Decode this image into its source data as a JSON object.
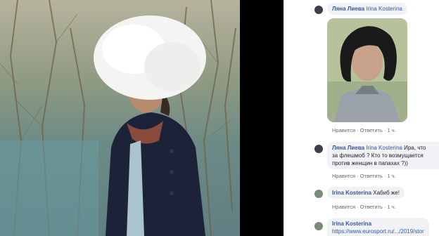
{
  "comments": [
    {
      "author": "Ляна Лиева",
      "mention": "Irina Kosterina",
      "text": "",
      "attachment": "photo",
      "actions": {
        "like": "Нравится",
        "reply": "Ответить",
        "time": "1 ч."
      },
      "avatar_icon": "user-avatar-icon"
    },
    {
      "author": "Ляна Лиева",
      "mention": "Irina Kosterina",
      "text_line1": "Ира, что",
      "text_line2": "за флешмоб ? Кто то возмущается",
      "text_line3": "против женщин в папахах ?))",
      "actions": {
        "like": "Нравится",
        "reply": "Ответить",
        "time": "1 ч."
      },
      "avatar_icon": "user-avatar-icon"
    },
    {
      "author": "Irina Kosterina",
      "text": "Хабиб же!",
      "actions": {
        "like": "Нравится",
        "reply": "Ответить",
        "time": "1 ч."
      },
      "avatar_icon": "user-avatar-icon"
    },
    {
      "author": "Irina Kosterina",
      "link": "https://www.eurosport.ru/.../2019/stor",
      "avatar_icon": "user-avatar-icon"
    }
  ],
  "separator": "·",
  "colors": {
    "link": "#385898",
    "bubble": "#f0f2f5",
    "meta": "#65676b"
  }
}
